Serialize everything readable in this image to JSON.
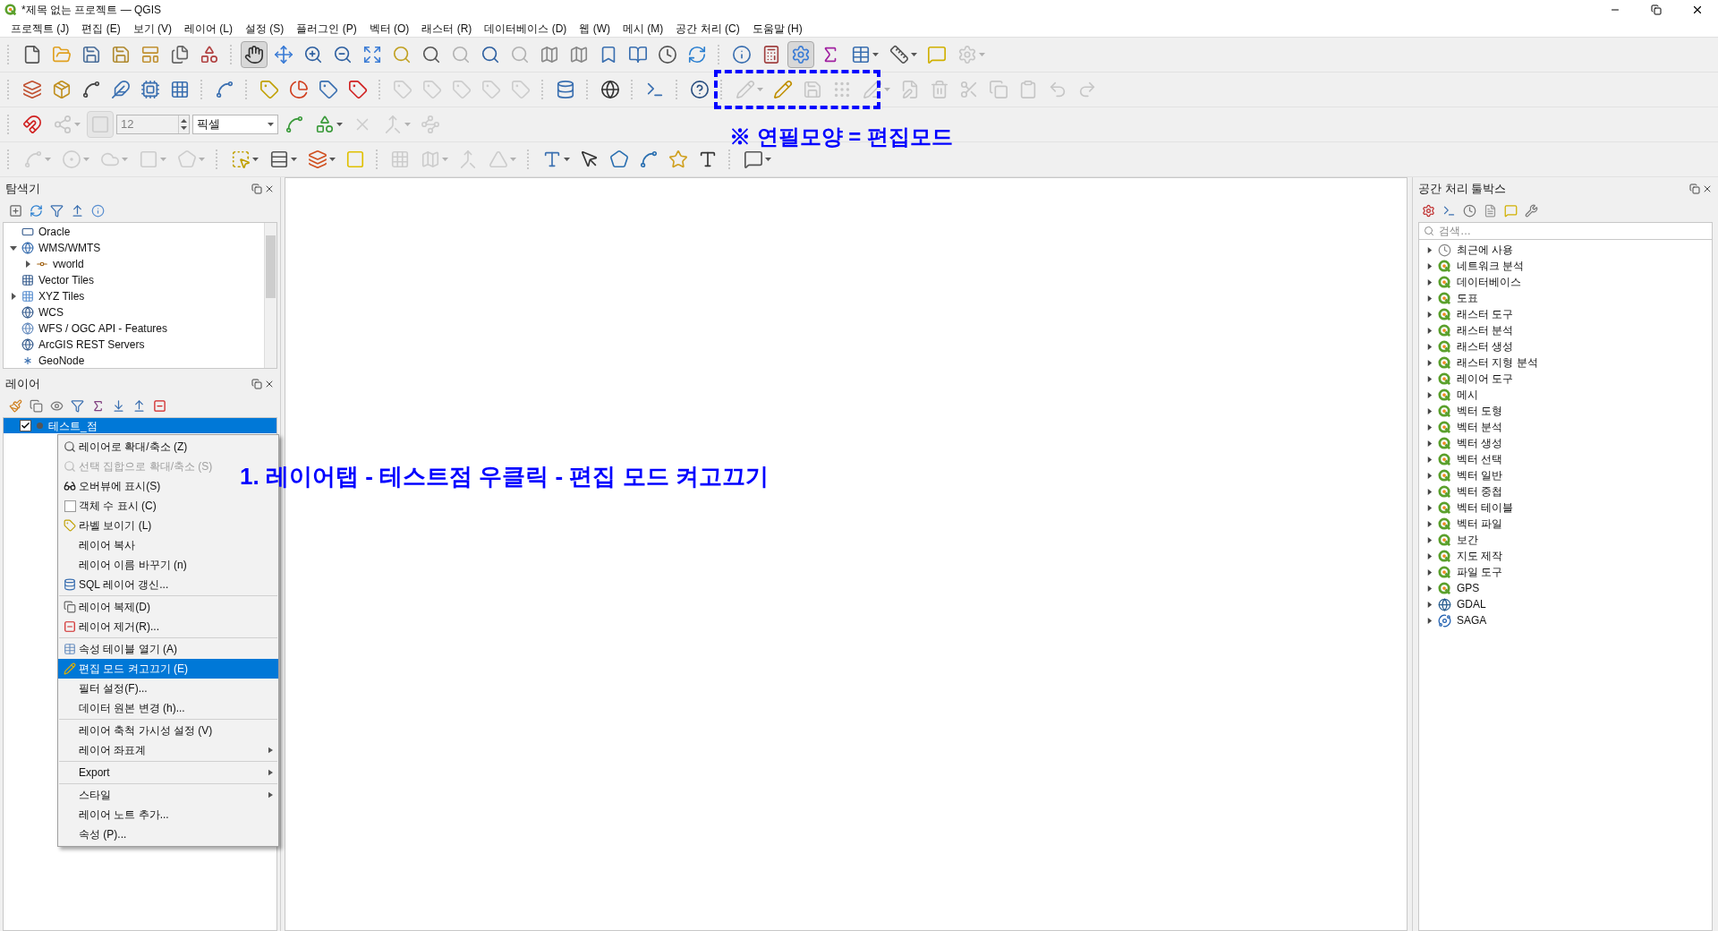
{
  "window": {
    "title": "*제목 없는 프로젝트 — QGIS"
  },
  "menu_bar": [
    "프로젝트 (J)",
    "편집 (E)",
    "보기 (V)",
    "레이어 (L)",
    "설정 (S)",
    "플러그인 (P)",
    "벡터 (O)",
    "래스터 (R)",
    "데이터베이스 (D)",
    "웹 (W)",
    "메시 (M)",
    "공간 처리 (C)",
    "도움말 (H)"
  ],
  "toolbars": [
    {
      "items": [
        {
          "kind": "tool",
          "disabled": false,
          "selected": false,
          "dropdown": false
        },
        {
          "kind": "tool",
          "disabled": false,
          "selected": false,
          "dropdown": false
        },
        {
          "kind": "tool",
          "disabled": false,
          "selected": false,
          "dropdown": false
        },
        {
          "kind": "tool",
          "disabled": false,
          "selected": false,
          "dropdown": false
        },
        {
          "kind": "tool",
          "disabled": false,
          "selected": false,
          "dropdown": false
        },
        {
          "kind": "tool",
          "disabled": false,
          "selected": false,
          "dropdown": false
        },
        {
          "kind": "tool",
          "disabled": false,
          "selected": false,
          "dropdown": false
        },
        {
          "kind": "separator"
        },
        {
          "kind": "tool",
          "disabled": false,
          "selected": true,
          "dropdown": false
        },
        {
          "kind": "tool",
          "disabled": false,
          "selected": false,
          "dropdown": false
        },
        {
          "kind": "tool",
          "disabled": false,
          "selected": false,
          "dropdown": false
        },
        {
          "kind": "tool",
          "disabled": false,
          "selected": false,
          "dropdown": false
        },
        {
          "kind": "tool",
          "disabled": false,
          "selected": false,
          "dropdown": false
        },
        {
          "kind": "tool",
          "disabled": false,
          "selected": false,
          "dropdown": false
        },
        {
          "kind": "tool",
          "disabled": false,
          "selected": false,
          "dropdown": false
        },
        {
          "kind": "tool",
          "disabled": true,
          "selected": false,
          "dropdown": false
        },
        {
          "kind": "tool",
          "disabled": false,
          "selected": false,
          "dropdown": false
        },
        {
          "kind": "tool",
          "disabled": true,
          "selected": false,
          "dropdown": false
        },
        {
          "kind": "tool",
          "disabled": false,
          "selected": false,
          "dropdown": false
        },
        {
          "kind": "tool",
          "disabled": false,
          "selected": false,
          "dropdown": false
        },
        {
          "kind": "tool",
          "disabled": false,
          "selected": false,
          "dropdown": false
        },
        {
          "kind": "tool",
          "disabled": false,
          "selected": false,
          "dropdown": false
        },
        {
          "kind": "tool",
          "disabled": false,
          "selected": false,
          "dropdown": false
        },
        {
          "kind": "tool",
          "disabled": false,
          "selected": false,
          "dropdown": false
        },
        {
          "kind": "separator"
        },
        {
          "kind": "tool",
          "disabled": false,
          "selected": false,
          "dropdown": false
        },
        {
          "kind": "tool",
          "disabled": false,
          "selected": false,
          "dropdown": false
        },
        {
          "kind": "tool",
          "disabled": false,
          "selected": true,
          "dropdown": false
        },
        {
          "kind": "tool",
          "disabled": false,
          "selected": false,
          "dropdown": false
        },
        {
          "kind": "tool",
          "disabled": false,
          "selected": false,
          "dropdown": true
        },
        {
          "kind": "tool",
          "disabled": false,
          "selected": false,
          "dropdown": true
        },
        {
          "kind": "tool",
          "disabled": false,
          "selected": false,
          "dropdown": false
        },
        {
          "kind": "tool",
          "disabled": true,
          "selected": false,
          "dropdown": true
        }
      ]
    },
    {
      "items": [
        {
          "kind": "tool",
          "disabled": false,
          "selected": false,
          "dropdown": false
        },
        {
          "kind": "tool",
          "disabled": false,
          "selected": false,
          "dropdown": false
        },
        {
          "kind": "tool",
          "disabled": false,
          "selected": false,
          "dropdown": false
        },
        {
          "kind": "tool",
          "disabled": false,
          "selected": false,
          "dropdown": false
        },
        {
          "kind": "tool",
          "disabled": false,
          "selected": false,
          "dropdown": false
        },
        {
          "kind": "tool",
          "disabled": false,
          "selected": false,
          "dropdown": false
        },
        {
          "kind": "separator"
        },
        {
          "kind": "tool",
          "disabled": false,
          "selected": false,
          "dropdown": false
        },
        {
          "kind": "separator"
        },
        {
          "kind": "tool",
          "disabled": false,
          "selected": false,
          "dropdown": false
        },
        {
          "kind": "tool",
          "disabled": false,
          "selected": false,
          "dropdown": false
        },
        {
          "kind": "tool",
          "disabled": false,
          "selected": false,
          "dropdown": false
        },
        {
          "kind": "tool",
          "disabled": false,
          "selected": false,
          "dropdown": false
        },
        {
          "kind": "separator"
        },
        {
          "kind": "tool",
          "disabled": true,
          "selected": false,
          "dropdown": false
        },
        {
          "kind": "tool",
          "disabled": true,
          "selected": false,
          "dropdown": false
        },
        {
          "kind": "tool",
          "disabled": true,
          "selected": false,
          "dropdown": false
        },
        {
          "kind": "tool",
          "disabled": true,
          "selected": false,
          "dropdown": false
        },
        {
          "kind": "tool",
          "disabled": true,
          "selected": false,
          "dropdown": false
        },
        {
          "kind": "separator"
        },
        {
          "kind": "tool",
          "disabled": false,
          "selected": false,
          "dropdown": false
        },
        {
          "kind": "separator"
        },
        {
          "kind": "tool",
          "disabled": false,
          "selected": false,
          "dropdown": false
        },
        {
          "kind": "separator"
        },
        {
          "kind": "tool",
          "disabled": false,
          "selected": false,
          "dropdown": false
        },
        {
          "kind": "separator"
        },
        {
          "kind": "tool",
          "disabled": false,
          "selected": false,
          "dropdown": false
        },
        {
          "kind": "separator"
        },
        {
          "kind": "tool",
          "disabled": true,
          "selected": false,
          "dropdown": true
        },
        {
          "kind": "tool",
          "disabled": false,
          "selected": false,
          "dropdown": false
        },
        {
          "kind": "tool",
          "disabled": true,
          "selected": false,
          "dropdown": false
        },
        {
          "kind": "tool",
          "disabled": true,
          "selected": false,
          "dropdown": false
        },
        {
          "kind": "tool",
          "disabled": true,
          "selected": false,
          "dropdown": true
        },
        {
          "kind": "tool",
          "disabled": true,
          "selected": false,
          "dropdown": false
        },
        {
          "kind": "tool",
          "disabled": true,
          "selected": false,
          "dropdown": false
        },
        {
          "kind": "tool",
          "disabled": true,
          "selected": false,
          "dropdown": false
        },
        {
          "kind": "tool",
          "disabled": true,
          "selected": false,
          "dropdown": false
        },
        {
          "kind": "tool",
          "disabled": true,
          "selected": false,
          "dropdown": false
        },
        {
          "kind": "tool",
          "disabled": true,
          "selected": false,
          "dropdown": false
        },
        {
          "kind": "tool",
          "disabled": true,
          "selected": false,
          "dropdown": false
        }
      ]
    },
    {
      "items": [
        {
          "kind": "tool",
          "disabled": false,
          "selected": false,
          "dropdown": false
        },
        {
          "kind": "tool",
          "disabled": true,
          "selected": false,
          "dropdown": true
        },
        {
          "kind": "tool",
          "disabled": true,
          "selected": true,
          "dropdown": false
        },
        {
          "kind": "spin",
          "value": "12",
          "disabled": true
        },
        {
          "kind": "select",
          "value": "픽셀",
          "disabled": false
        },
        {
          "kind": "tool",
          "disabled": false,
          "selected": false,
          "dropdown": false
        },
        {
          "kind": "tool",
          "disabled": false,
          "selected": false,
          "dropdown": true
        },
        {
          "kind": "tool",
          "disabled": true,
          "selected": false,
          "dropdown": false
        },
        {
          "kind": "tool",
          "disabled": true,
          "selected": false,
          "dropdown": true
        },
        {
          "kind": "tool",
          "disabled": true,
          "selected": false,
          "dropdown": false
        }
      ]
    },
    {
      "items": [
        {
          "kind": "tool",
          "disabled": true,
          "selected": false,
          "dropdown": true
        },
        {
          "kind": "tool",
          "disabled": true,
          "selected": false,
          "dropdown": true
        },
        {
          "kind": "tool",
          "disabled": true,
          "selected": false,
          "dropdown": true
        },
        {
          "kind": "tool",
          "disabled": true,
          "selected": false,
          "dropdown": true
        },
        {
          "kind": "tool",
          "disabled": true,
          "selected": false,
          "dropdown": true
        },
        {
          "kind": "separator"
        },
        {
          "kind": "tool",
          "disabled": false,
          "selected": false,
          "dropdown": true
        },
        {
          "kind": "tool",
          "disabled": false,
          "selected": false,
          "dropdown": true
        },
        {
          "kind": "tool",
          "disabled": false,
          "selected": false,
          "dropdown": true
        },
        {
          "kind": "tool",
          "disabled": false,
          "selected": false,
          "dropdown": false
        },
        {
          "kind": "separator"
        },
        {
          "kind": "tool",
          "disabled": true,
          "selected": false,
          "dropdown": false
        },
        {
          "kind": "tool",
          "disabled": true,
          "selected": false,
          "dropdown": true
        },
        {
          "kind": "tool",
          "disabled": true,
          "selected": false,
          "dropdown": false
        },
        {
          "kind": "tool",
          "disabled": true,
          "selected": false,
          "dropdown": true
        },
        {
          "kind": "separator"
        },
        {
          "kind": "tool",
          "disabled": false,
          "selected": false,
          "dropdown": true
        },
        {
          "kind": "tool",
          "disabled": false,
          "selected": false,
          "dropdown": false
        },
        {
          "kind": "tool",
          "disabled": false,
          "selected": false,
          "dropdown": false
        },
        {
          "kind": "tool",
          "disabled": false,
          "selected": false,
          "dropdown": false
        },
        {
          "kind": "tool",
          "disabled": false,
          "selected": false,
          "dropdown": false
        },
        {
          "kind": "tool",
          "disabled": false,
          "selected": false,
          "dropdown": false
        },
        {
          "kind": "separator"
        },
        {
          "kind": "tool",
          "disabled": false,
          "selected": false,
          "dropdown": true
        }
      ]
    }
  ],
  "browser": {
    "title": "탐색기",
    "items": [
      {
        "label": "Oracle"
      },
      {
        "label": "WMS/WMTS",
        "expanded": true,
        "children": [
          {
            "label": "vworld",
            "expanded": false
          }
        ]
      },
      {
        "label": "Vector Tiles"
      },
      {
        "label": "XYZ Tiles",
        "expanded": false
      },
      {
        "label": "WCS"
      },
      {
        "label": "WFS / OGC API - Features"
      },
      {
        "label": "ArcGIS REST Servers"
      },
      {
        "label": "GeoNode"
      }
    ]
  },
  "layers": {
    "title": "레이어",
    "items": [
      {
        "name": "테스트_점",
        "visible": true,
        "selected": true
      }
    ]
  },
  "context_menu": [
    {
      "kind": "item",
      "label": "레이어로 확대/축소 (Z)",
      "disabled": false,
      "selected": false,
      "submenu": false
    },
    {
      "kind": "item",
      "label": "선택 집합으로 확대/축소 (S)",
      "disabled": true,
      "selected": false,
      "submenu": false
    },
    {
      "kind": "item",
      "label": "오버뷰에 표시(S)",
      "disabled": false,
      "selected": false,
      "submenu": false
    },
    {
      "kind": "check",
      "label": "객체 수 표시 (C)",
      "checked": false,
      "disabled": false,
      "selected": false,
      "submenu": false
    },
    {
      "kind": "item",
      "label": "라벨 보이기 (L)",
      "disabled": false,
      "selected": false,
      "submenu": false
    },
    {
      "kind": "item",
      "label": "레이어 복사",
      "disabled": false,
      "selected": false,
      "submenu": false
    },
    {
      "kind": "item",
      "label": "레이어 이름 바꾸기 (n)",
      "disabled": false,
      "selected": false,
      "submenu": false
    },
    {
      "kind": "item",
      "label": "SQL 레이어 갱신...",
      "disabled": false,
      "selected": false,
      "submenu": false
    },
    {
      "kind": "separator"
    },
    {
      "kind": "item",
      "label": "레이어 복제(D)",
      "disabled": false,
      "selected": false,
      "submenu": false
    },
    {
      "kind": "item",
      "label": "레이어 제거(R)...",
      "disabled": false,
      "selected": false,
      "submenu": false
    },
    {
      "kind": "separator"
    },
    {
      "kind": "item",
      "label": "속성 테이블 열기 (A)",
      "disabled": false,
      "selected": false,
      "submenu": false
    },
    {
      "kind": "item",
      "label": "편집 모드 켜고끄기 (E)",
      "disabled": false,
      "selected": true,
      "submenu": false
    },
    {
      "kind": "item",
      "label": "필터 설정(F)...",
      "disabled": false,
      "selected": false,
      "submenu": false
    },
    {
      "kind": "item",
      "label": "데이터 원본 변경 (h)...",
      "disabled": false,
      "selected": false,
      "submenu": false
    },
    {
      "kind": "separator"
    },
    {
      "kind": "item",
      "label": "레이어 축척 가시성 설정 (V)",
      "disabled": false,
      "selected": false,
      "submenu": false
    },
    {
      "kind": "item",
      "label": "레이어 좌표계",
      "disabled": false,
      "selected": false,
      "submenu": true
    },
    {
      "kind": "separator"
    },
    {
      "kind": "item",
      "label": "Export",
      "disabled": false,
      "selected": false,
      "submenu": true
    },
    {
      "kind": "separator"
    },
    {
      "kind": "item",
      "label": "스타일",
      "disabled": false,
      "selected": false,
      "submenu": true
    },
    {
      "kind": "item",
      "label": "레이어 노트 추가...",
      "disabled": false,
      "selected": false,
      "submenu": false
    },
    {
      "kind": "item",
      "label": "속성 (P)...",
      "disabled": false,
      "selected": false,
      "submenu": false
    }
  ],
  "toolbox": {
    "title": "공간 처리 툴박스",
    "search": {
      "placeholder": "검색…"
    },
    "items": [
      {
        "kind": "recent",
        "label": "최근에 사용"
      },
      {
        "kind": "qgis",
        "label": "네트워크 분석"
      },
      {
        "kind": "qgis",
        "label": "데이터베이스"
      },
      {
        "kind": "qgis",
        "label": "도표"
      },
      {
        "kind": "qgis",
        "label": "래스터 도구"
      },
      {
        "kind": "qgis",
        "label": "래스터 분석"
      },
      {
        "kind": "qgis",
        "label": "래스터 생성"
      },
      {
        "kind": "qgis",
        "label": "래스터 지형 분석"
      },
      {
        "kind": "qgis",
        "label": "레이어 도구"
      },
      {
        "kind": "qgis",
        "label": "메시"
      },
      {
        "kind": "qgis",
        "label": "벡터 도형"
      },
      {
        "kind": "qgis",
        "label": "벡터 분석"
      },
      {
        "kind": "qgis",
        "label": "벡터 생성"
      },
      {
        "kind": "qgis",
        "label": "벡터 선택"
      },
      {
        "kind": "qgis",
        "label": "벡터 일반"
      },
      {
        "kind": "qgis",
        "label": "벡터 중첩"
      },
      {
        "kind": "qgis",
        "label": "벡터 테이블"
      },
      {
        "kind": "qgis",
        "label": "벡터 파일"
      },
      {
        "kind": "qgis",
        "label": "보간"
      },
      {
        "kind": "qgis",
        "label": "지도 제작"
      },
      {
        "kind": "qgis",
        "label": "파일 도구"
      },
      {
        "kind": "qgis",
        "label": "GPS"
      },
      {
        "kind": "gdal",
        "label": "GDAL"
      },
      {
        "kind": "saga",
        "label": "SAGA"
      }
    ]
  },
  "annotations": {
    "step": "1. 레이어탭 - 테스트점 우클릭 - 편집 모드 켜고끄기",
    "note": "※ 연필모양 = 편집모드"
  }
}
